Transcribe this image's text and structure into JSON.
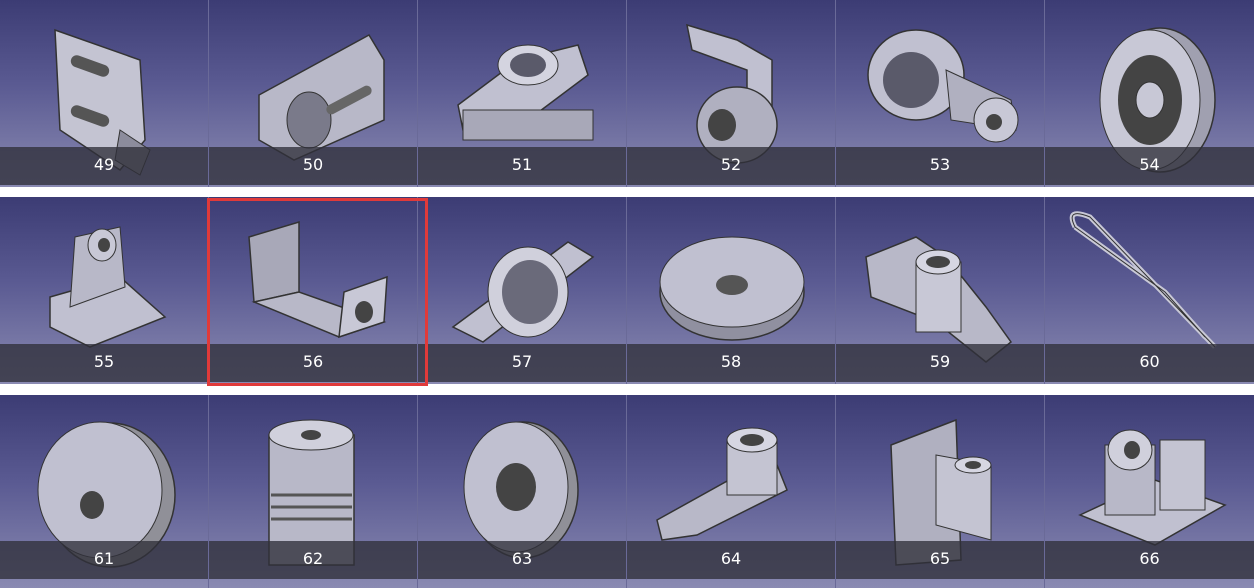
{
  "gallery": {
    "rows": [
      {
        "tiles": [
          {
            "label": "49",
            "icon": "bracket-plate-part-icon"
          },
          {
            "label": "50",
            "icon": "clamp-block-part-icon"
          },
          {
            "label": "51",
            "icon": "flange-bearing-part-icon"
          },
          {
            "label": "52",
            "icon": "hook-arm-part-icon"
          },
          {
            "label": "53",
            "icon": "lever-housing-part-icon"
          },
          {
            "label": "54",
            "icon": "pulley-wheel-part-icon"
          }
        ]
      },
      {
        "tiles": [
          {
            "label": "55",
            "icon": "pillow-bracket-part-icon"
          },
          {
            "label": "56",
            "icon": "u-bracket-part-icon"
          },
          {
            "label": "57",
            "icon": "oval-flange-part-icon"
          },
          {
            "label": "58",
            "icon": "sprocket-gear-part-icon"
          },
          {
            "label": "59",
            "icon": "arm-support-part-icon"
          },
          {
            "label": "60",
            "icon": "wire-spring-part-icon"
          }
        ]
      },
      {
        "tiles": [
          {
            "label": "61",
            "icon": "disc-plate-part-icon"
          },
          {
            "label": "62",
            "icon": "shaft-coupling-part-icon"
          },
          {
            "label": "63",
            "icon": "slotted-ring-part-icon"
          },
          {
            "label": "64",
            "icon": "rocker-arm-part-icon"
          },
          {
            "label": "65",
            "icon": "angle-mount-part-icon"
          },
          {
            "label": "66",
            "icon": "bearing-housing-part-icon"
          }
        ]
      }
    ],
    "selected": "56",
    "colors": {
      "tile_gradient_top": "#3c3c74",
      "tile_gradient_bottom": "#8a8ab2",
      "caption_band": "#30303a",
      "selection_border": "#e03a3a",
      "part_fill": "#b8b8c8"
    }
  }
}
